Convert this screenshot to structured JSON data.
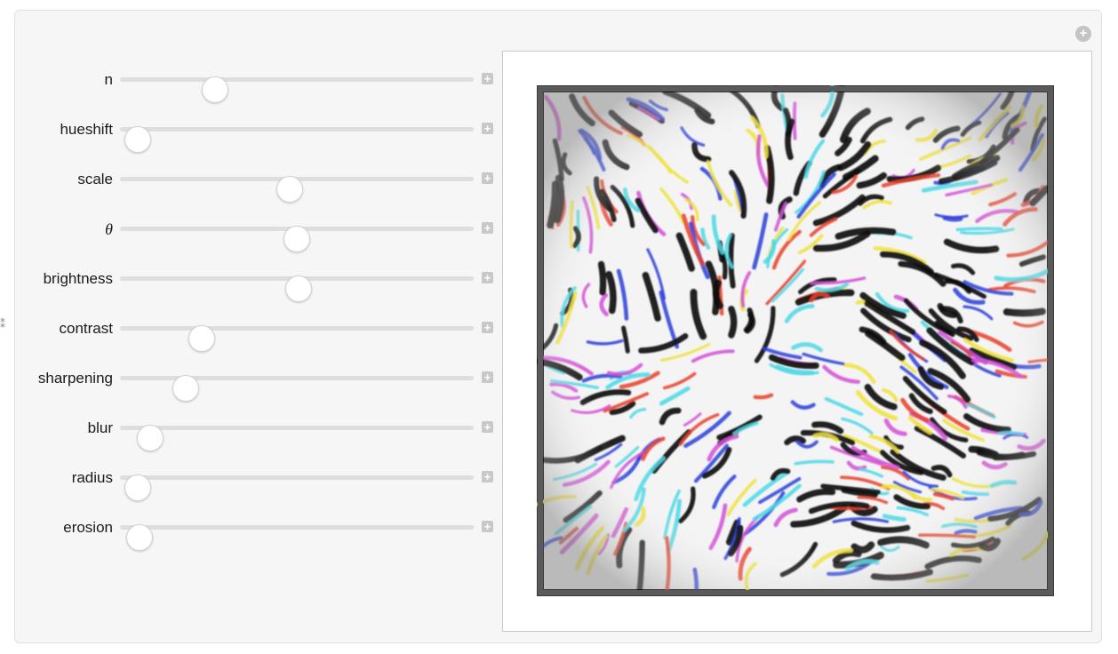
{
  "window": {
    "corner_button_icon": "plus-circle-icon",
    "edge_mark": "⁑"
  },
  "controls": [
    {
      "key": "n",
      "label": "n",
      "value": 0.27
    },
    {
      "key": "hueshift",
      "label": "hueshift",
      "value": 0.05
    },
    {
      "key": "scale",
      "label": "scale",
      "value": 0.48
    },
    {
      "key": "theta",
      "label": "θ",
      "value": 0.5
    },
    {
      "key": "brightness",
      "label": "brightness",
      "value": 0.505
    },
    {
      "key": "contrast",
      "label": "contrast",
      "value": 0.23
    },
    {
      "key": "sharpening",
      "label": "sharpening",
      "value": 0.185
    },
    {
      "key": "blur",
      "label": "blur",
      "value": 0.085
    },
    {
      "key": "radius",
      "label": "radius",
      "value": 0.05
    },
    {
      "key": "erosion",
      "label": "erosion",
      "value": 0.055
    }
  ],
  "output": {
    "description": "noise-pattern-image",
    "colors": {
      "frame": "#3a3a3a",
      "black": "#111111",
      "white": "#ffffff",
      "cyan": "#4ad8e6",
      "red": "#e8412c",
      "blue": "#2b3fd8",
      "yellow": "#f0e23a",
      "magenta": "#d24fd6",
      "green": "#3fbf4a"
    }
  }
}
